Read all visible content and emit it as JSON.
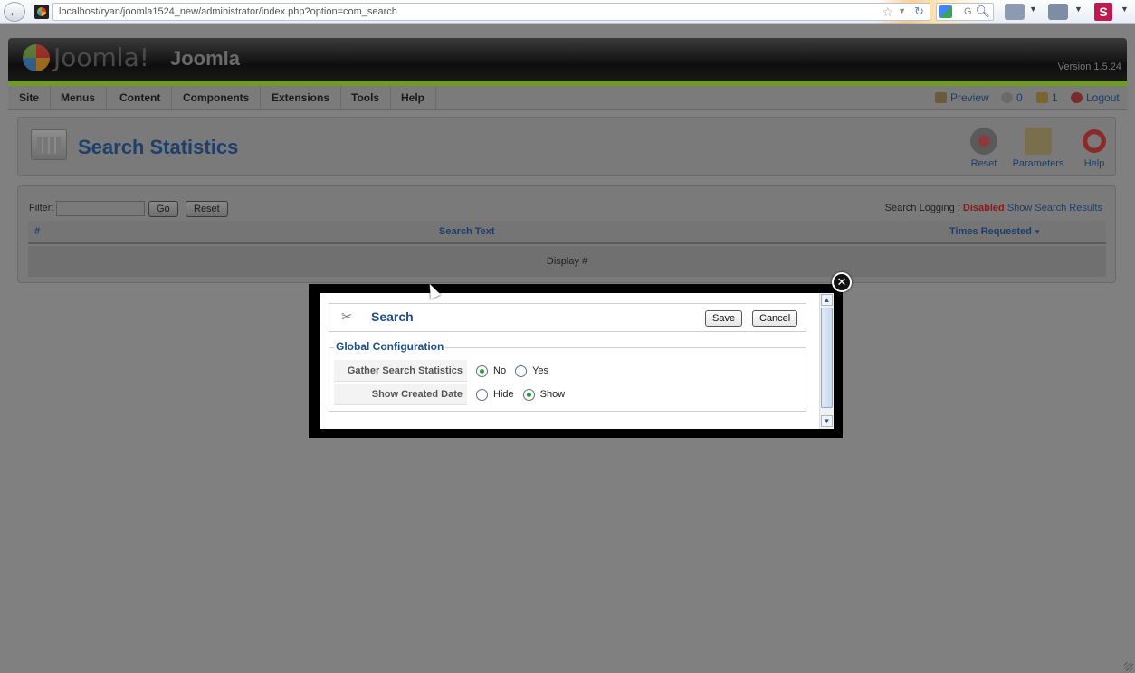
{
  "browser": {
    "url": "localhost/ryan/joomla1524_new/administrator/index.php?option=com_search",
    "search_engine_letter": "G",
    "extension_letter": "S"
  },
  "header": {
    "logo_text": "Joomla!",
    "site_name": "Joomla",
    "version": "Version 1.5.24"
  },
  "menu": {
    "items": [
      "Site",
      "Menus",
      "Content",
      "Components",
      "Extensions",
      "Tools",
      "Help"
    ]
  },
  "status": {
    "preview": "Preview",
    "messages": "0",
    "users": "1",
    "logout": "Logout"
  },
  "toolbar": {
    "title": "Search Statistics",
    "reset": "Reset",
    "parameters": "Parameters",
    "help": "Help"
  },
  "filter": {
    "label": "Filter:",
    "value": "",
    "go": "Go",
    "reset": "Reset",
    "logging_label": "Search Logging :",
    "logging_value": "Disabled",
    "show_results": "Show Search Results"
  },
  "table": {
    "col_num": "#",
    "col_text": "Search Text",
    "col_times": "Times Requested",
    "footer": "Display #"
  },
  "modal": {
    "title": "Search",
    "save": "Save",
    "cancel": "Cancel",
    "legend": "Global Configuration",
    "rows": [
      {
        "label": "Gather Search Statistics",
        "options": [
          "No",
          "Yes"
        ],
        "selected": "No"
      },
      {
        "label": "Show Created Date",
        "options": [
          "Hide",
          "Show"
        ],
        "selected": "Show"
      }
    ]
  },
  "colors": {
    "accent": "#1d4e8a",
    "header_green": "#6f9d24",
    "disabled_red": "#8a1a1a"
  }
}
